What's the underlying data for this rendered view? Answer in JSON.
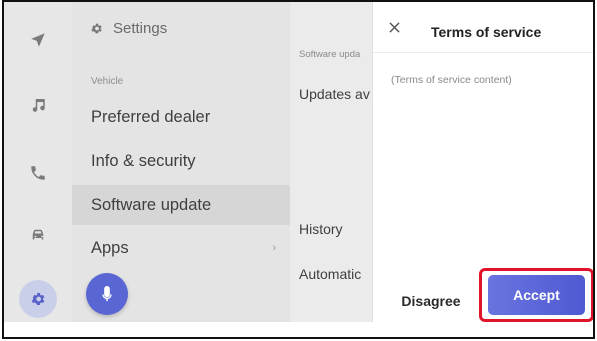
{
  "settings": {
    "title": "Settings",
    "section": "Vehicle",
    "items": [
      {
        "label": "Preferred dealer"
      },
      {
        "label": "Info & security"
      },
      {
        "label": "Software update"
      },
      {
        "label": "Apps"
      }
    ]
  },
  "content": {
    "small": "Software upda",
    "line1": "Updates av",
    "history": "History",
    "automatic": "Automatic"
  },
  "dialog": {
    "title": "Terms of service",
    "body": "(Terms of service content)",
    "disagree_label": "Disagree",
    "accept_label": "Accept"
  },
  "colors": {
    "accent": "#5a66d3",
    "highlight": "#e0142a"
  },
  "icons": [
    "navigation-icon",
    "music-icon",
    "phone-icon",
    "car-icon",
    "gear-icon",
    "microphone-icon",
    "close-icon"
  ]
}
